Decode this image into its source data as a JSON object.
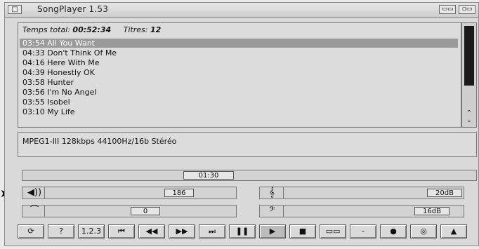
{
  "window": {
    "title": "SongPlayer 1.53",
    "close_icon": "close-gadget-icon",
    "depth_icons": [
      "zoom-gadget-icon",
      "depth-gadget-icon"
    ]
  },
  "playlist": {
    "total_label": "Temps total:",
    "total_value": "00:52:34",
    "titles_label": "Titres:",
    "titles_value": "12",
    "tracks": [
      {
        "time": "03:54",
        "title": "All You Want",
        "selected": true
      },
      {
        "time": "04:33",
        "title": "Don't Think Of Me",
        "selected": false
      },
      {
        "time": "04:16",
        "title": "Here With Me",
        "selected": false
      },
      {
        "time": "04:39",
        "title": "Honestly OK",
        "selected": false
      },
      {
        "time": "03:58",
        "title": "Hunter",
        "selected": false
      },
      {
        "time": "03:56",
        "title": "I'm No Angel",
        "selected": false
      },
      {
        "time": "03:55",
        "title": "Isobel",
        "selected": false
      },
      {
        "time": "03:10",
        "title": "My Life",
        "selected": false
      }
    ]
  },
  "info": {
    "stream_text": "MPEG1-III 128kbps  44100Hz/16b Stéréo"
  },
  "position": {
    "time": "01:30"
  },
  "controls": {
    "volume_value": "186",
    "balance_value": "0",
    "treble_value": "20dB",
    "bass_value": "16dB"
  },
  "buttons": [
    {
      "name": "repeat-button",
      "glyph": "⟳"
    },
    {
      "name": "help-button",
      "glyph": "?"
    },
    {
      "name": "numbers-button",
      "glyph": "1.2.3"
    },
    {
      "name": "first-track-button",
      "glyph": "⏮"
    },
    {
      "name": "rewind-button",
      "glyph": "◀◀"
    },
    {
      "name": "forward-button",
      "glyph": "▶▶"
    },
    {
      "name": "last-track-button",
      "glyph": "⏭"
    },
    {
      "name": "pause-button",
      "glyph": "❚❚"
    },
    {
      "name": "play-button",
      "glyph": "▶"
    },
    {
      "name": "stop-button",
      "glyph": "■"
    },
    {
      "name": "playlist-button",
      "glyph": "▭▭"
    },
    {
      "name": "minus-button",
      "glyph": "-"
    },
    {
      "name": "record-button",
      "glyph": "●"
    },
    {
      "name": "cd-button",
      "glyph": "◎"
    },
    {
      "name": "eject-button",
      "glyph": "▲"
    }
  ]
}
